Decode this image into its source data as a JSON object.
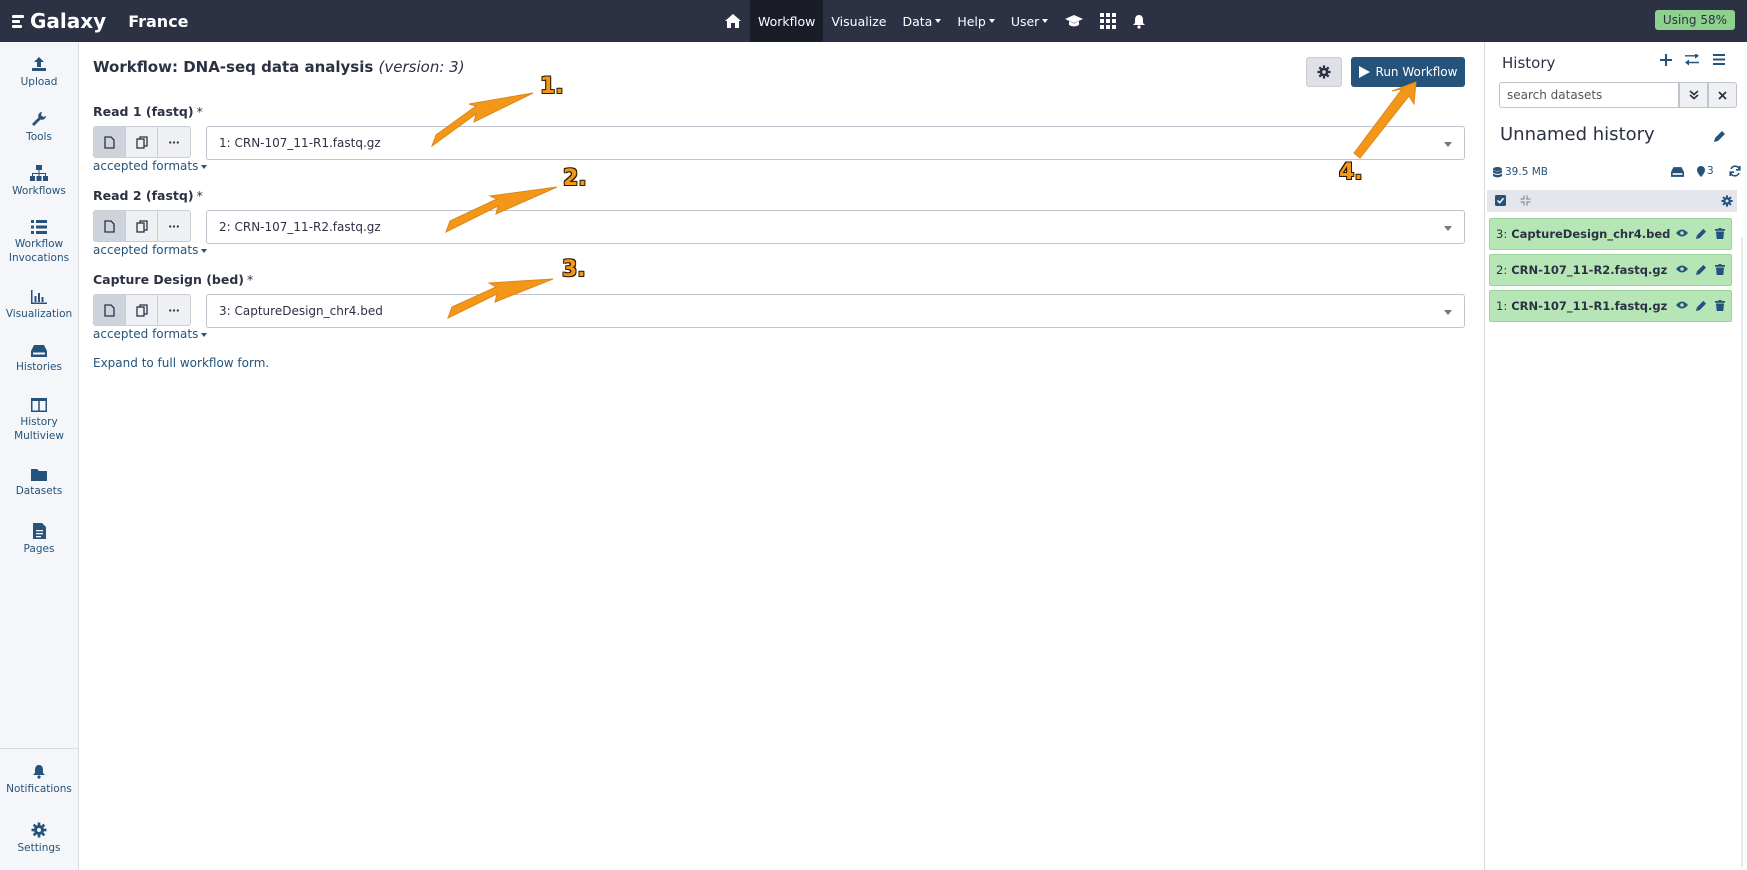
{
  "brand": {
    "name": "Galaxy",
    "subsite": "France"
  },
  "nav": {
    "workflow": "Workflow",
    "visualize": "Visualize",
    "data": "Data",
    "help": "Help",
    "user": "User",
    "quota": "Using 58%"
  },
  "activity": {
    "upload": "Upload",
    "tools": "Tools",
    "workflows": "Workflows",
    "invocations_1": "Workflow",
    "invocations_2": "Invocations",
    "visualization": "Visualization",
    "histories": "Histories",
    "multiview_1": "History",
    "multiview_2": "Multiview",
    "datasets": "Datasets",
    "pages": "Pages",
    "notifications": "Notifications",
    "settings": "Settings"
  },
  "workflow": {
    "title": "Workflow: DNA-seq data analysis",
    "version": "(version: 3)",
    "run_label": "Run Workflow",
    "expand_link": "Expand to full workflow form.",
    "accepted_formats": "accepted formats",
    "inputs": [
      {
        "label": "Read 1 (fastq)",
        "required": "*",
        "value": "1: CRN-107_11-R1.fastq.gz"
      },
      {
        "label": "Read 2 (fastq)",
        "required": "*",
        "value": "2: CRN-107_11-R2.fastq.gz"
      },
      {
        "label": "Capture Design (bed)",
        "required": "*",
        "value": "3: CaptureDesign_chr4.bed"
      }
    ]
  },
  "annotations": [
    "1.",
    "2.",
    "3.",
    "4."
  ],
  "history": {
    "title": "History",
    "search_placeholder": "search datasets",
    "name": "Unnamed history",
    "size": "39.5 MB",
    "count": "3",
    "datasets": [
      {
        "hid": "3:",
        "name": "CaptureDesign_chr4.bed"
      },
      {
        "hid": "2:",
        "name": "CRN-107_11-R2.fastq.gz"
      },
      {
        "hid": "1:",
        "name": "CRN-107_11-R1.fastq.gz"
      }
    ]
  },
  "colors": {
    "navbar": "#2c3143",
    "primary": "#25537b",
    "dataset_ok": "#b6e6b6",
    "annotation": "#f39719",
    "quota": "#8ed18e"
  }
}
